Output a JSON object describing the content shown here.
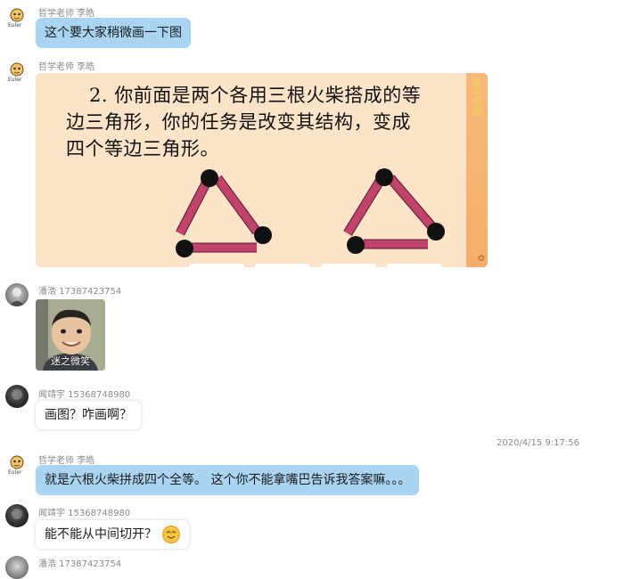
{
  "messages": {
    "m1": {
      "sender": "哲学老师 李皓",
      "text": "这个要大家稍微画一下图"
    },
    "m2": {
      "sender": "哲学老师 李皓",
      "slide": {
        "line1": "2. 你前面是两个各用三根火柴搭成的等",
        "line2": "边三角形，你的任务是改变其结构，变成",
        "line3": "四个等边三角形。",
        "side_label": "数学乐园"
      }
    },
    "m3": {
      "sender": "潘浩  17387423754",
      "photo_caption": "迷之微笑"
    },
    "m4": {
      "sender": "闻靖宇 15368748980",
      "text": "画图？咋画啊？"
    },
    "timestamp": "2020/4/15 9:17:56",
    "m5": {
      "sender": "哲学老师 李皓",
      "text": "就是六根火柴拼成四个全等。 这个你不能拿嘴巴告诉我答案嘛。。。"
    },
    "m6": {
      "sender": "闻靖宇 15368748980",
      "text": "能不能从中间切开？"
    },
    "m7": {
      "sender": "潘浩  17387423754"
    }
  },
  "colors": {
    "blue_bubble": "#a9d4f2",
    "slide_bg": "#fde3c8",
    "match_stick": "#c0446a",
    "match_head": "#111111"
  }
}
